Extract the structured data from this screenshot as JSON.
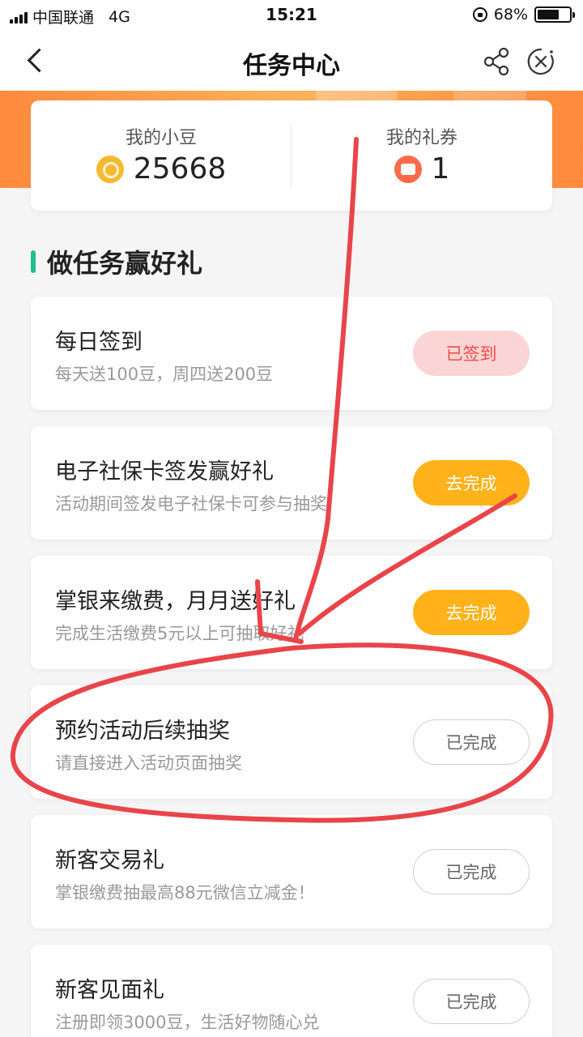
{
  "status_bar": {
    "carrier": "中国联通",
    "network": "4G",
    "time": "15:21",
    "battery": "68%",
    "battery_level": 0.68
  },
  "nav": {
    "title": "任务中心",
    "back_icon": "chevron-left-icon",
    "share_icon": "share-icon",
    "close_icon": "close-icon"
  },
  "summary": {
    "beans_label": "我的小豆",
    "beans_value": "25668",
    "coupons_label": "我的礼券",
    "coupons_value": "1"
  },
  "section": {
    "title": "做任务赢好礼"
  },
  "tasks": [
    {
      "title": "每日签到",
      "desc": "每天送100豆，周四送200豆",
      "button": "已签到",
      "state": "signed"
    },
    {
      "title": "电子社保卡签发赢好礼",
      "desc": "活动期间签发电子社保卡可参与抽奖",
      "button": "去完成",
      "state": "go"
    },
    {
      "title": "掌银来缴费，月月送好礼",
      "desc": "完成生活缴费5元以上可抽取好礼",
      "button": "去完成",
      "state": "go"
    },
    {
      "title": "预约活动后续抽奖",
      "desc": "请直接进入活动页面抽奖",
      "button": "已完成",
      "state": "done"
    },
    {
      "title": "新客交易礼",
      "desc": "掌银缴费抽最高88元微信立减金！",
      "button": "已完成",
      "state": "done"
    },
    {
      "title": "新客见面礼",
      "desc": "注册即领3000豆，生活好物随心兑",
      "button": "已完成",
      "state": "done"
    }
  ],
  "colors": {
    "accent_orange": "#ffb21a",
    "section_bar": "#1fbf8f",
    "annotation_red": "#e8454a"
  }
}
